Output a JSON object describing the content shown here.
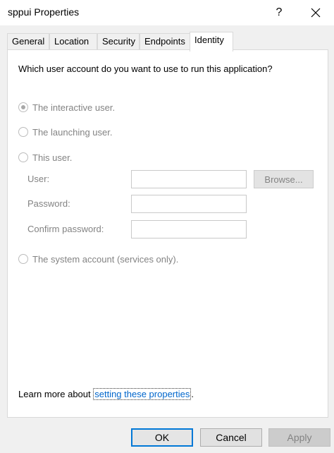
{
  "window": {
    "title": "sppui Properties",
    "help_label": "?"
  },
  "tabs": [
    {
      "label": "General",
      "active": false
    },
    {
      "label": "Location",
      "active": false
    },
    {
      "label": "Security",
      "active": false
    },
    {
      "label": "Endpoints",
      "active": false
    },
    {
      "label": "Identity",
      "active": true
    }
  ],
  "identity": {
    "question": "Which user account do you want to use to run this application?",
    "options": {
      "interactive_user": "The interactive user.",
      "launching_user": "The launching user.",
      "this_user": "This user.",
      "system_account": "The system account (services only)."
    },
    "selected_option": "interactive_user",
    "fields": {
      "user_label": "User:",
      "user_value": "",
      "password_label": "Password:",
      "password_value": "",
      "confirm_label": "Confirm password:",
      "confirm_value": ""
    },
    "browse_label": "Browse...",
    "learn_more_prefix": "Learn more about ",
    "learn_more_link": "setting these properties",
    "learn_more_suffix": "."
  },
  "buttons": {
    "ok": "OK",
    "cancel": "Cancel",
    "apply": "Apply"
  },
  "colors": {
    "link": "#0066cc",
    "focus_border": "#0078d7",
    "disabled_text": "#838383"
  }
}
